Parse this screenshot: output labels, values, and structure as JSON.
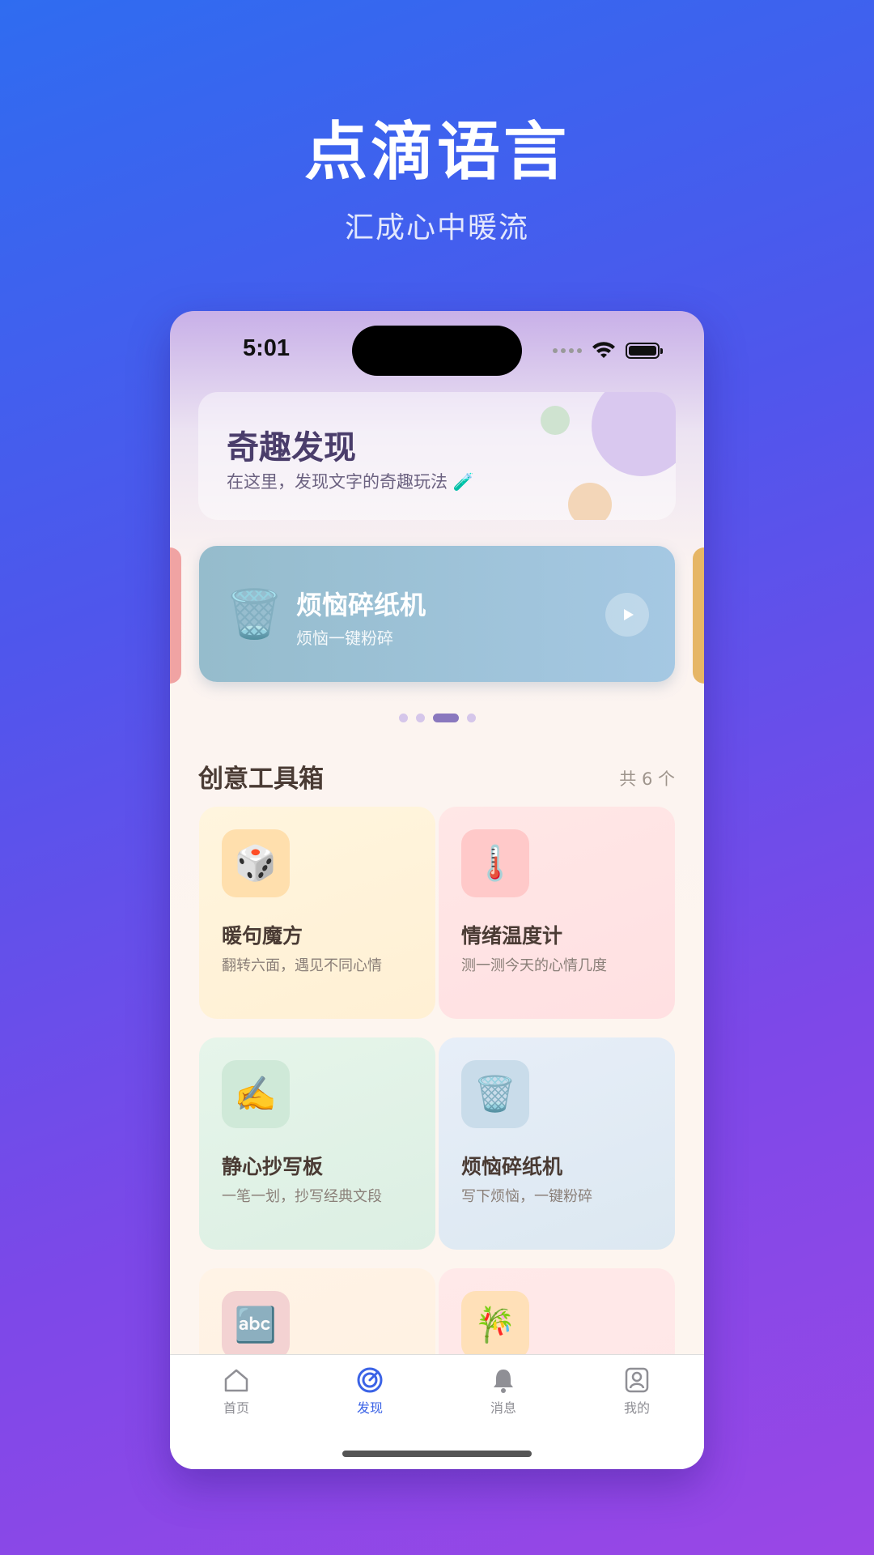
{
  "hero": {
    "title": "点滴语言",
    "subtitle": "汇成心中暖流"
  },
  "status": {
    "time": "5:01"
  },
  "discover": {
    "title": "奇趣发现",
    "subtitle": "在这里，发现文字的奇趣玩法 🧪"
  },
  "carousel": {
    "title": "烦恼碎纸机",
    "subtitle": "烦恼一键粉碎",
    "icon": "🗑️",
    "page_count": 4,
    "active_page": 3
  },
  "toolbox": {
    "title": "创意工具箱",
    "count_label": "共 6 个",
    "tools": [
      {
        "icon": "🎲",
        "name": "暖句魔方",
        "desc": "翻转六面，遇见不同心情"
      },
      {
        "icon": "🌡️",
        "name": "情绪温度计",
        "desc": "测一测今天的心情几度"
      },
      {
        "icon": "✍️",
        "name": "静心抄写板",
        "desc": "一笔一划，抄写经典文段"
      },
      {
        "icon": "🗑️",
        "name": "烦恼碎纸机",
        "desc": "写下烦恼，一键粉碎"
      },
      {
        "icon": "🔤",
        "name": "",
        "desc": ""
      },
      {
        "icon": "🎋",
        "name": "",
        "desc": ""
      }
    ]
  },
  "tabbar": {
    "items": [
      {
        "label": "首页",
        "icon": "home-icon"
      },
      {
        "label": "发现",
        "icon": "discover-icon",
        "active": true
      },
      {
        "label": "消息",
        "icon": "bell-icon"
      },
      {
        "label": "我的",
        "icon": "profile-icon"
      }
    ]
  },
  "colors": {
    "accent": "#3b63e6",
    "brand_gradient_start": "#2f6cf0",
    "brand_gradient_end": "#9a47e6"
  }
}
